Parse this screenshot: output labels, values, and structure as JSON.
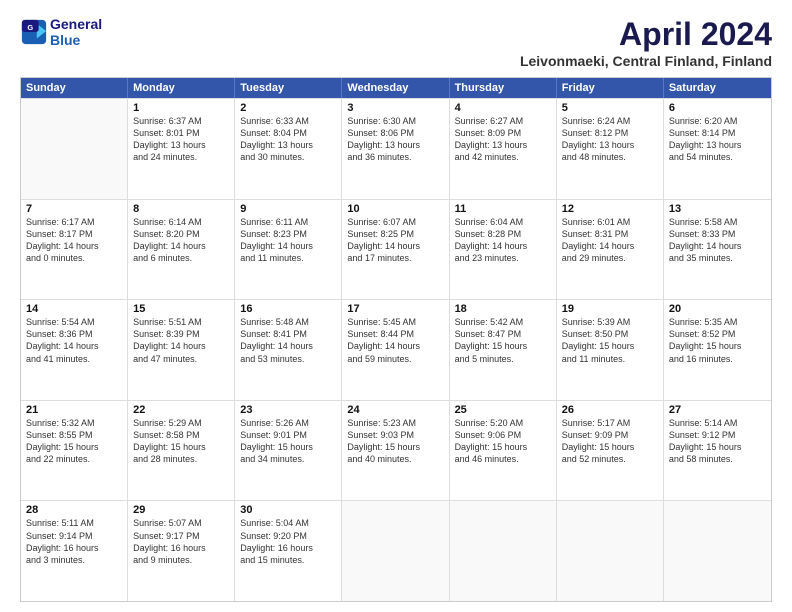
{
  "header": {
    "logo_line1": "General",
    "logo_line2": "Blue",
    "month_title": "April 2024",
    "location": "Leivonmaeki, Central Finland, Finland"
  },
  "weekdays": [
    "Sunday",
    "Monday",
    "Tuesday",
    "Wednesday",
    "Thursday",
    "Friday",
    "Saturday"
  ],
  "weeks": [
    [
      {
        "day": "",
        "info": ""
      },
      {
        "day": "1",
        "info": "Sunrise: 6:37 AM\nSunset: 8:01 PM\nDaylight: 13 hours\nand 24 minutes."
      },
      {
        "day": "2",
        "info": "Sunrise: 6:33 AM\nSunset: 8:04 PM\nDaylight: 13 hours\nand 30 minutes."
      },
      {
        "day": "3",
        "info": "Sunrise: 6:30 AM\nSunset: 8:06 PM\nDaylight: 13 hours\nand 36 minutes."
      },
      {
        "day": "4",
        "info": "Sunrise: 6:27 AM\nSunset: 8:09 PM\nDaylight: 13 hours\nand 42 minutes."
      },
      {
        "day": "5",
        "info": "Sunrise: 6:24 AM\nSunset: 8:12 PM\nDaylight: 13 hours\nand 48 minutes."
      },
      {
        "day": "6",
        "info": "Sunrise: 6:20 AM\nSunset: 8:14 PM\nDaylight: 13 hours\nand 54 minutes."
      }
    ],
    [
      {
        "day": "7",
        "info": "Sunrise: 6:17 AM\nSunset: 8:17 PM\nDaylight: 14 hours\nand 0 minutes."
      },
      {
        "day": "8",
        "info": "Sunrise: 6:14 AM\nSunset: 8:20 PM\nDaylight: 14 hours\nand 6 minutes."
      },
      {
        "day": "9",
        "info": "Sunrise: 6:11 AM\nSunset: 8:23 PM\nDaylight: 14 hours\nand 11 minutes."
      },
      {
        "day": "10",
        "info": "Sunrise: 6:07 AM\nSunset: 8:25 PM\nDaylight: 14 hours\nand 17 minutes."
      },
      {
        "day": "11",
        "info": "Sunrise: 6:04 AM\nSunset: 8:28 PM\nDaylight: 14 hours\nand 23 minutes."
      },
      {
        "day": "12",
        "info": "Sunrise: 6:01 AM\nSunset: 8:31 PM\nDaylight: 14 hours\nand 29 minutes."
      },
      {
        "day": "13",
        "info": "Sunrise: 5:58 AM\nSunset: 8:33 PM\nDaylight: 14 hours\nand 35 minutes."
      }
    ],
    [
      {
        "day": "14",
        "info": "Sunrise: 5:54 AM\nSunset: 8:36 PM\nDaylight: 14 hours\nand 41 minutes."
      },
      {
        "day": "15",
        "info": "Sunrise: 5:51 AM\nSunset: 8:39 PM\nDaylight: 14 hours\nand 47 minutes."
      },
      {
        "day": "16",
        "info": "Sunrise: 5:48 AM\nSunset: 8:41 PM\nDaylight: 14 hours\nand 53 minutes."
      },
      {
        "day": "17",
        "info": "Sunrise: 5:45 AM\nSunset: 8:44 PM\nDaylight: 14 hours\nand 59 minutes."
      },
      {
        "day": "18",
        "info": "Sunrise: 5:42 AM\nSunset: 8:47 PM\nDaylight: 15 hours\nand 5 minutes."
      },
      {
        "day": "19",
        "info": "Sunrise: 5:39 AM\nSunset: 8:50 PM\nDaylight: 15 hours\nand 11 minutes."
      },
      {
        "day": "20",
        "info": "Sunrise: 5:35 AM\nSunset: 8:52 PM\nDaylight: 15 hours\nand 16 minutes."
      }
    ],
    [
      {
        "day": "21",
        "info": "Sunrise: 5:32 AM\nSunset: 8:55 PM\nDaylight: 15 hours\nand 22 minutes."
      },
      {
        "day": "22",
        "info": "Sunrise: 5:29 AM\nSunset: 8:58 PM\nDaylight: 15 hours\nand 28 minutes."
      },
      {
        "day": "23",
        "info": "Sunrise: 5:26 AM\nSunset: 9:01 PM\nDaylight: 15 hours\nand 34 minutes."
      },
      {
        "day": "24",
        "info": "Sunrise: 5:23 AM\nSunset: 9:03 PM\nDaylight: 15 hours\nand 40 minutes."
      },
      {
        "day": "25",
        "info": "Sunrise: 5:20 AM\nSunset: 9:06 PM\nDaylight: 15 hours\nand 46 minutes."
      },
      {
        "day": "26",
        "info": "Sunrise: 5:17 AM\nSunset: 9:09 PM\nDaylight: 15 hours\nand 52 minutes."
      },
      {
        "day": "27",
        "info": "Sunrise: 5:14 AM\nSunset: 9:12 PM\nDaylight: 15 hours\nand 58 minutes."
      }
    ],
    [
      {
        "day": "28",
        "info": "Sunrise: 5:11 AM\nSunset: 9:14 PM\nDaylight: 16 hours\nand 3 minutes."
      },
      {
        "day": "29",
        "info": "Sunrise: 5:07 AM\nSunset: 9:17 PM\nDaylight: 16 hours\nand 9 minutes."
      },
      {
        "day": "30",
        "info": "Sunrise: 5:04 AM\nSunset: 9:20 PM\nDaylight: 16 hours\nand 15 minutes."
      },
      {
        "day": "",
        "info": ""
      },
      {
        "day": "",
        "info": ""
      },
      {
        "day": "",
        "info": ""
      },
      {
        "day": "",
        "info": ""
      }
    ]
  ]
}
